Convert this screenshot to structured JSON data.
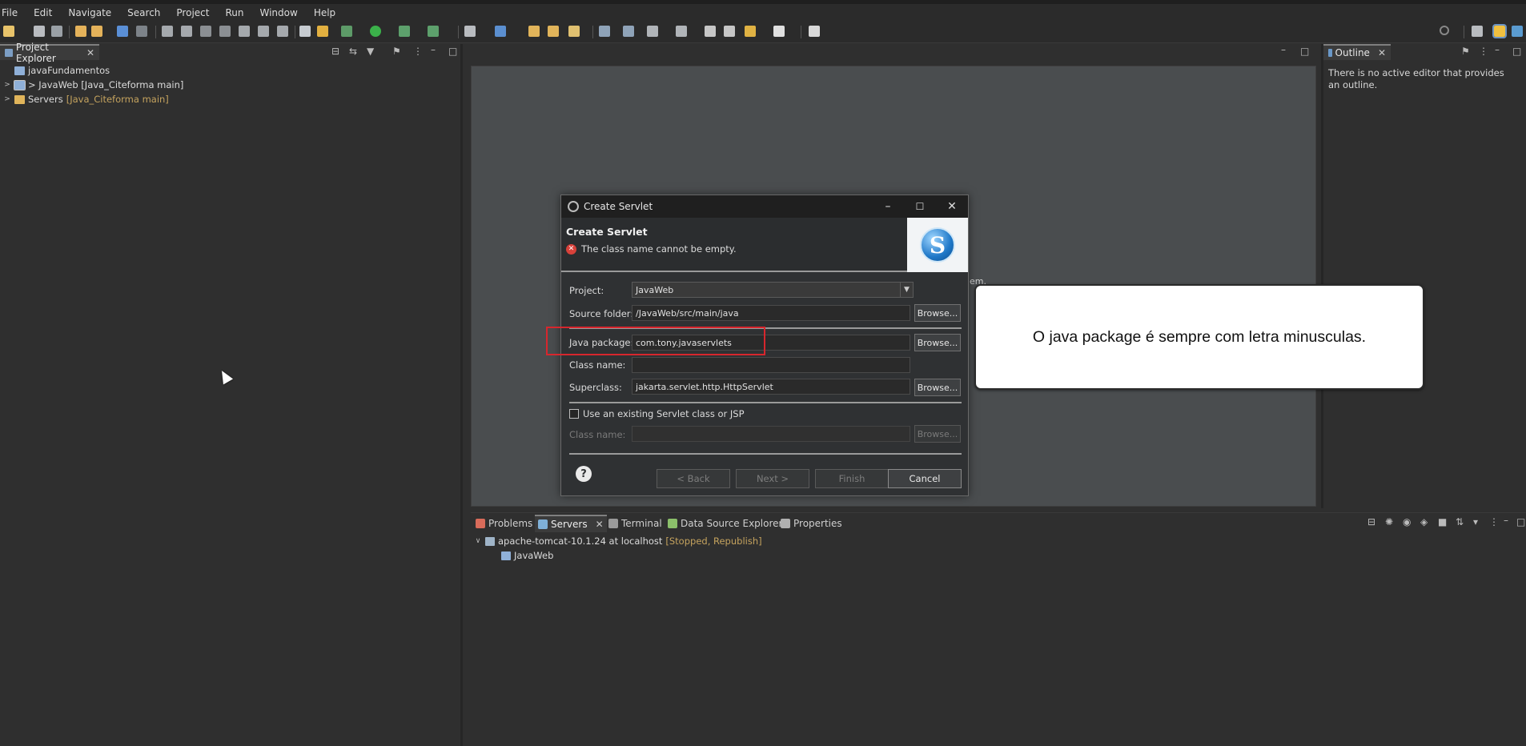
{
  "menubar": {
    "items": [
      "File",
      "Edit",
      "Navigate",
      "Search",
      "Project",
      "Run",
      "Window",
      "Help"
    ]
  },
  "explorer": {
    "tab_label": "Project Explorer",
    "tree": [
      {
        "label": "javaFundamentos",
        "suffix": ""
      },
      {
        "label": "> JavaWeb [Java_Citeforma main]",
        "suffix": ""
      },
      {
        "label": "Servers ",
        "suffix": "[Java_Citeforma main]"
      }
    ]
  },
  "outline": {
    "tab_label": "Outline",
    "message": "There is no active editor that provides an outline."
  },
  "editor": {
    "partial_text": "em."
  },
  "bottom": {
    "tabs": [
      "Problems",
      "Servers",
      "Terminal",
      "Data Source Explorer",
      "Properties"
    ],
    "active_tab": "Servers",
    "server": {
      "name": "apache-tomcat-10.1.24 at localhost",
      "status": "[Stopped, Republish]"
    },
    "module": "JavaWeb"
  },
  "dialog": {
    "title": "Create Servlet",
    "banner_title": "Create Servlet",
    "error_message": "The class name cannot be empty.",
    "logo_letter": "S",
    "project_label": "Project:",
    "project_value": "JavaWeb",
    "source_folder_label": "Source folder:",
    "source_folder_value": "/JavaWeb/src/main/java",
    "java_package_label": "Java package:",
    "java_package_value": "com.tony.javaservlets",
    "class_name_label": "Class name:",
    "class_name_value": "",
    "superclass_label": "Superclass:",
    "superclass_value": "jakarta.servlet.http.HttpServlet",
    "browse_label": "Browse...",
    "use_existing_label": "Use an existing Servlet class or JSP",
    "existing_class_name_label": "Class name:",
    "help_label": "?",
    "back_label": "< Back",
    "next_label": "Next >",
    "finish_label": "Finish",
    "cancel_label": "Cancel"
  },
  "callout": {
    "text": "O java package é sempre com letra minusculas."
  },
  "colors": {
    "highlight_border": "#d7262d",
    "status_text": "#c5a35e",
    "error_icon": "#d8413a"
  }
}
